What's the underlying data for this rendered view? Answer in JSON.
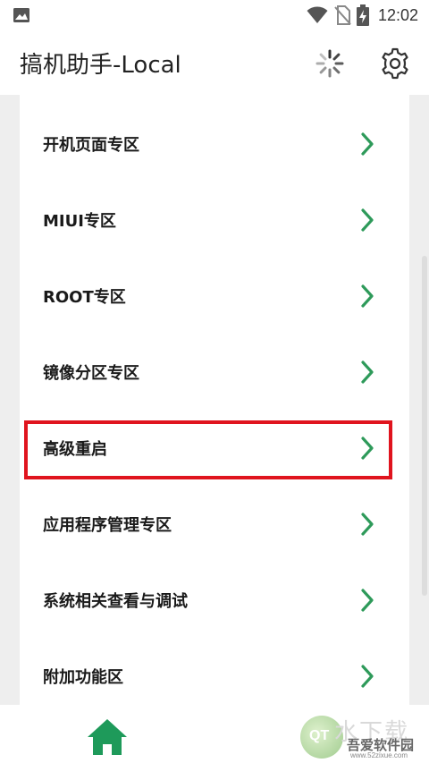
{
  "status_bar": {
    "time": "12:02",
    "icons": [
      "image-notification-icon",
      "wifi-icon",
      "no-sim-icon",
      "battery-charging-icon"
    ]
  },
  "app_bar": {
    "title": "搞机助手-Local",
    "icons": [
      "loading-spinner-icon",
      "gear-icon"
    ]
  },
  "menu": {
    "items": [
      {
        "label": "开机页面专区"
      },
      {
        "label": "MIUI专区"
      },
      {
        "label": "ROOT专区"
      },
      {
        "label": "镜像分区专区"
      },
      {
        "label": "高级重启",
        "highlighted": true
      },
      {
        "label": "应用程序管理专区"
      },
      {
        "label": "系统相关查看与调试"
      },
      {
        "label": "附加功能区"
      }
    ]
  },
  "bottom_nav": {
    "icons": [
      "home-icon"
    ]
  },
  "watermark": {
    "text_big": "水下载",
    "text_small": "吾爱软件园",
    "url": "www.52zixue.com",
    "logo_text": "QT"
  },
  "colors": {
    "accent_green": "#2e9a5a",
    "highlight_red": "#e0141e",
    "background_gray": "#eeeeee"
  }
}
